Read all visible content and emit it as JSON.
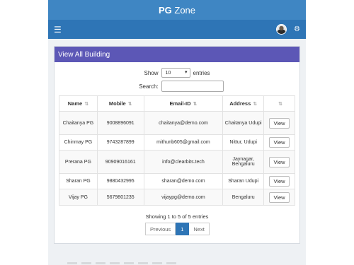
{
  "brand": {
    "bold": "PG",
    "rest": " Zone"
  },
  "navbar": {
    "menu_icon": "hamburger-icon",
    "avatar": "user-avatar",
    "settings_icon": "cogs-icon"
  },
  "panel": {
    "title": "View All Building"
  },
  "controls": {
    "show_label": "Show",
    "entries_value": "10",
    "entries_label": "entries",
    "search_label": "Search:",
    "search_value": ""
  },
  "table": {
    "headers": [
      "Name",
      "Mobile",
      "Email-ID",
      "Address",
      ""
    ],
    "sort_icon": "⇅",
    "rows": [
      {
        "name": "Chaitanya PG",
        "mobile": "9008896091",
        "email": "chaitanya@demo.com",
        "address": "Chaitanya Udupi",
        "action": "View"
      },
      {
        "name": "Chinmay PG",
        "mobile": "9743287899",
        "email": "mithunb605@gmail.com",
        "address": "Nittur, Udupi",
        "action": "View"
      },
      {
        "name": "Prerana PG",
        "mobile": "90909016161",
        "email": "info@clearbits.tech",
        "address": "Jaynagar, Bengaluru",
        "action": "View"
      },
      {
        "name": "Sharan PG",
        "mobile": "9880432995",
        "email": "sharan@demo.com",
        "address": "Sharan Udupi",
        "action": "View"
      },
      {
        "name": "Vijay PG",
        "mobile": "5679801235",
        "email": "vijaypg@demo.com",
        "address": "Bengaluru",
        "action": "View"
      }
    ]
  },
  "info": "Showing 1 to 5 of 5 entries",
  "pagination": {
    "previous": "Previous",
    "current": "1",
    "next": "Next"
  }
}
